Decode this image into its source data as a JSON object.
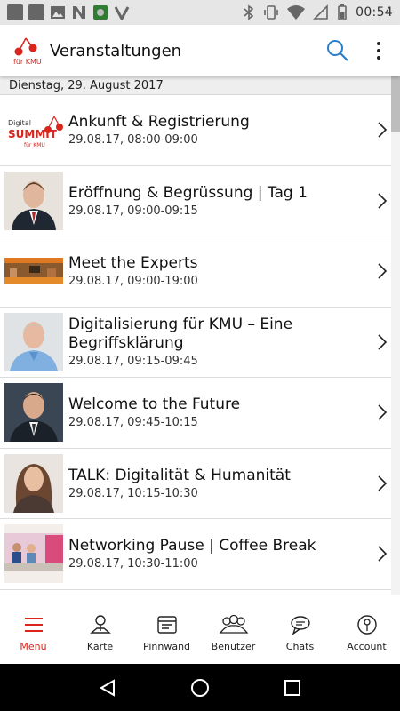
{
  "status_bar": {
    "time": "00:54",
    "left_icons": [
      "image-icon",
      "image-icon",
      "photo-icon",
      "n-app-icon",
      "game-icon",
      "check-icon"
    ],
    "right_icons": [
      "bluetooth-icon",
      "vibrate-icon",
      "wifi-icon",
      "no-signal-icon",
      "battery-icon"
    ]
  },
  "app_bar": {
    "title": "Veranstaltungen",
    "logo_text": "für KMU",
    "accent": "#d9251c",
    "search_color": "#2a7fc9"
  },
  "date_header": "Dienstag, 29. August 2017",
  "events": [
    {
      "title": "Ankunft & Registrierung",
      "time": "29.08.17, 08:00-09:00",
      "thumb": "digital-summit-logo"
    },
    {
      "title": "Eröffnung & Begrüssung | Tag 1",
      "time": "29.08.17, 09:00-09:15",
      "thumb": "speaker-photo"
    },
    {
      "title": "Meet the Experts",
      "time": "29.08.17, 09:00-19:00",
      "thumb": "exhibition-photo"
    },
    {
      "title": "Digitalisierung für KMU – Eine Begriffsklärung",
      "time": "29.08.17, 09:15-09:45",
      "thumb": "speaker-photo"
    },
    {
      "title": "Welcome to the Future",
      "time": "29.08.17, 09:45-10:15",
      "thumb": "speaker-photo"
    },
    {
      "title": "TALK: Digitalität & Humanität",
      "time": "29.08.17, 10:15-10:30",
      "thumb": "speaker-photo"
    },
    {
      "title": "Networking Pause | Coffee Break",
      "time": "29.08.17, 10:30-11:00",
      "thumb": "networking-photo"
    }
  ],
  "tabs": [
    {
      "label": "Menü",
      "icon": "hamburger-icon",
      "active": true
    },
    {
      "label": "Karte",
      "icon": "map-pin-icon",
      "active": false
    },
    {
      "label": "Pinnwand",
      "icon": "board-icon",
      "active": false
    },
    {
      "label": "Benutzer",
      "icon": "users-icon",
      "active": false
    },
    {
      "label": "Chats",
      "icon": "chat-icon",
      "active": false
    },
    {
      "label": "Account",
      "icon": "account-icon",
      "active": false
    }
  ]
}
